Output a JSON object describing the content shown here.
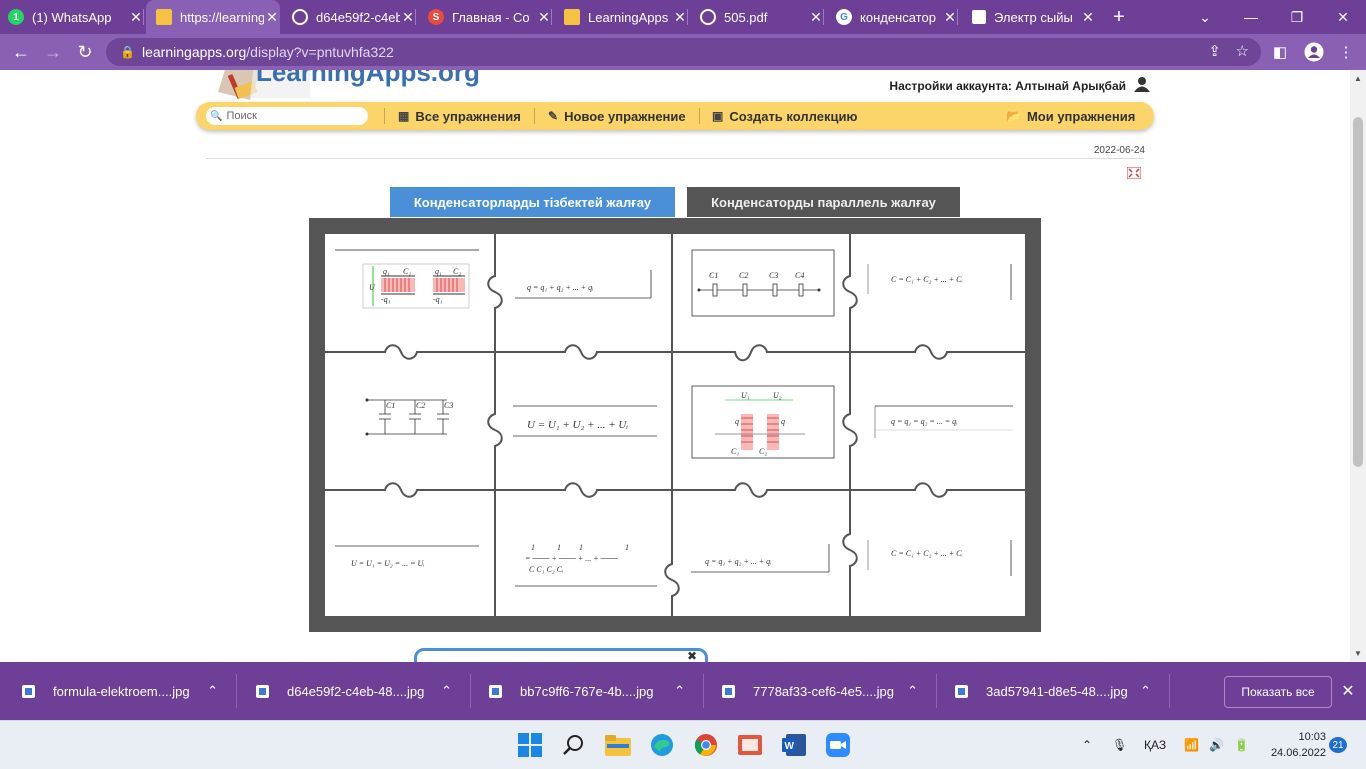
{
  "browser": {
    "tabs": [
      {
        "title": "(1) WhatsApp",
        "icon": "whatsapp-icon",
        "color": "#25d366"
      },
      {
        "title": "https://learningapps.org",
        "icon": "learningapps-icon",
        "color": "#f5c242"
      },
      {
        "title": "d64e59f2-c4eb",
        "icon": "globe-icon",
        "color": "#ffffff"
      },
      {
        "title": "Главная - Со",
        "icon": "s-logo-icon",
        "color": "#e84c3d"
      },
      {
        "title": "LearningApps",
        "icon": "learningapps-icon",
        "color": "#f5c242"
      },
      {
        "title": "505.pdf",
        "icon": "globe-icon",
        "color": "#ffffff"
      },
      {
        "title": "конденсатор",
        "icon": "google-icon",
        "color": "#ffffff"
      },
      {
        "title": "Электр сыйы",
        "icon": "document-icon",
        "color": "#ffffff"
      }
    ],
    "url_host": "learningapps.org",
    "url_path": "/display?v=pntuvhfa322"
  },
  "site": {
    "logo_text": "LearningApps.org",
    "account_label": "Настройки аккаунта: Алтынай Арықбай",
    "search_placeholder": "Поиск",
    "menu": {
      "all_exercises": "Все упражнения",
      "new_exercise": "Новое упражнение",
      "create_collection": "Создать коллекцию",
      "my_exercises": "Мои упражнения"
    },
    "date": "2022-06-24"
  },
  "puzzle": {
    "tab_active": "Конденсаторларды тізбектей жалғау",
    "tab_inactive": "Конденсаторды параллель жалғау",
    "active_color": "#4a90d9",
    "inactive_color": "#555555",
    "labels": {
      "c": "C",
      "c1": "C₁",
      "c2": "C₂",
      "cl1": "C1",
      "cl2": "C2",
      "cl3": "C3",
      "cl4": "C4",
      "q1": "q₁",
      "mq1": "-q₁",
      "u": "U",
      "u1": "U₁",
      "u2": "U₂",
      "q": "q",
      "one": "1"
    },
    "formulas": {
      "f_q_sum": "q = q₁ + q₂ + ... + qᵢ",
      "f_c_sum": "C = C₁ + C₂ + ... + Cᵢ",
      "f_u_sum": "U = U₁ + U₂ + ... + Uᵢ",
      "f_q_eq": "q = q₁ = q₂ = ... = qᵢ",
      "f_u_eq": "U = U₁ = U₂ = ... = Uᵢ",
      "f_q_sum2": "q = q₁ + q₂ + ... + qᵢ",
      "f_c_sum2": "C = C₁ + C₂ + ... + Cᵢ",
      "f_inv_terms": "= ───  + ─── + ... + ───",
      "f_inv_den": "C      C₁    C₂          Cᵢ"
    }
  },
  "downloads": {
    "items": [
      "formula-elektroem....jpg",
      "d64e59f2-c4eb-48....jpg",
      "bb7c9ff6-767e-4b....jpg",
      "7778af33-cef6-4e5....jpg",
      "3ad57941-d8e5-48....jpg"
    ],
    "show_all": "Показать все"
  },
  "taskbar": {
    "lang": "ҚАЗ",
    "time": "10:03",
    "date": "24.06.2022",
    "notifications": "21"
  }
}
